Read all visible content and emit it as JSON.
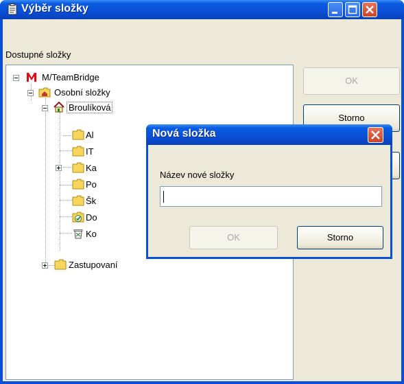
{
  "window": {
    "title": "Výběr složky"
  },
  "folders_label": "Dostupné složky",
  "tree": [
    {
      "label": "M/TeamBridge"
    },
    {
      "label": "Osobní složky"
    },
    {
      "label": "Broulíková"
    },
    {
      "label": "Al"
    },
    {
      "label": "IT"
    },
    {
      "label": "Ka"
    },
    {
      "label": "Po"
    },
    {
      "label": "Šk"
    },
    {
      "label": "Do"
    },
    {
      "label": "Ko"
    },
    {
      "label": "Zastupovaní"
    }
  ],
  "buttons": {
    "ok": "OK",
    "cancel": "Storno"
  },
  "dialog": {
    "title": "Nová složka",
    "field_label": "Název nové složky",
    "field_value": "",
    "ok": "OK",
    "cancel": "Storno"
  },
  "colors": {
    "titlebar": "#0a4fd6",
    "face": "#ece9d8",
    "close": "#c7452a"
  }
}
